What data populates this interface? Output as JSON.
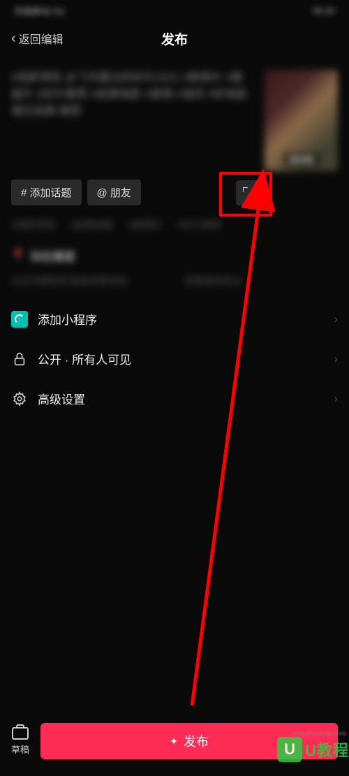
{
  "statusBar": {
    "left": "中国移动 5G",
    "right": "09:20"
  },
  "header": {
    "back": "返回编辑",
    "title": "发布"
  },
  "caption": {
    "text": "#电影预告 @飞鸟看过的好片2021 #剧情片 #悬疑片 #好片推荐 #经典电影 #爱情 #演员 #好电影难忘经典 推荐",
    "coverLabel": "选封面"
  },
  "chips": {
    "hashtag": "# 添加话题",
    "mention": "@ 朋友"
  },
  "hashtagSuggestions": [
    "#电影预告",
    "#经典电影",
    "#剧情片",
    "#好片推荐"
  ],
  "location": {
    "title": "你在哪里",
    "suggestions": [
      "北京市朝阳区某某某某地址",
      "某某某某地点"
    ]
  },
  "menu": {
    "miniapp": "添加小程序",
    "privacy": "公开 · 所有人可见",
    "advanced": "高级设置"
  },
  "bottom": {
    "draft": "草稿",
    "publish": "发布"
  },
  "watermark": {
    "badge": "U",
    "text": "U教程",
    "sub": "lnya.chanlidan.com"
  }
}
